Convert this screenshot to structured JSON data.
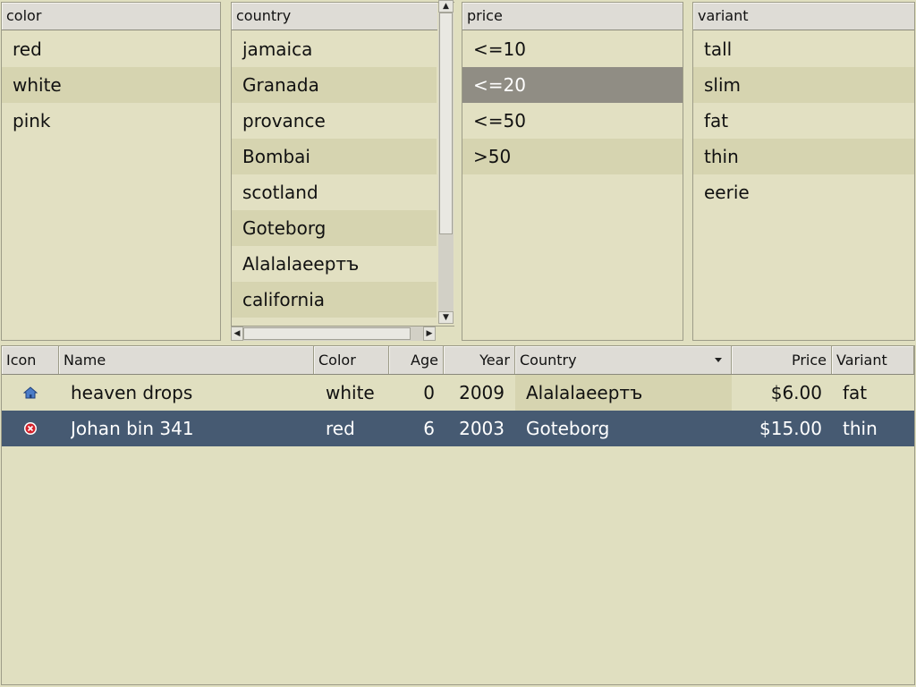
{
  "filters": {
    "color": {
      "header": "color",
      "items": [
        {
          "label": "red"
        },
        {
          "label": "white"
        },
        {
          "label": "pink"
        }
      ]
    },
    "country": {
      "header": "country",
      "items": [
        {
          "label": "jamaica"
        },
        {
          "label": "Granada"
        },
        {
          "label": "provance"
        },
        {
          "label": "Bombai"
        },
        {
          "label": "scotland"
        },
        {
          "label": "Goteborg"
        },
        {
          "label": "Alalalaeертъ"
        },
        {
          "label": "california"
        }
      ]
    },
    "price": {
      "header": "price",
      "items": [
        {
          "label": "<=10"
        },
        {
          "label": "<=20",
          "selected": true
        },
        {
          "label": "<=50"
        },
        {
          "label": ">50"
        }
      ]
    },
    "variant": {
      "header": "variant",
      "items": [
        {
          "label": "tall"
        },
        {
          "label": "slim"
        },
        {
          "label": "fat"
        },
        {
          "label": "thin"
        },
        {
          "label": "eerie"
        }
      ]
    }
  },
  "table": {
    "columns": {
      "icon": "Icon",
      "name": "Name",
      "color": "Color",
      "age": "Age",
      "year": "Year",
      "country": "Country",
      "price": "Price",
      "variant": "Variant"
    },
    "sorted_column": "Country",
    "rows": [
      {
        "icon": "home-icon",
        "name": "heaven drops",
        "color": "white",
        "age": "0",
        "year": "2009",
        "country": "Alalalaeертъ",
        "price": "$6.00",
        "variant": "fat"
      },
      {
        "icon": "error-icon",
        "name": "Johan bin 341",
        "color": "red",
        "age": "6",
        "year": "2003",
        "country": "Goteborg",
        "price": "$15.00",
        "variant": "thin",
        "selected": true
      }
    ]
  },
  "colors": {
    "background": "#e0dfc0",
    "alt_row": "#d6d4b0",
    "filter_selected": "#908d84",
    "row_selected": "#465a72",
    "home_icon": "#4a7cc8",
    "error_icon": "#d3202a"
  }
}
